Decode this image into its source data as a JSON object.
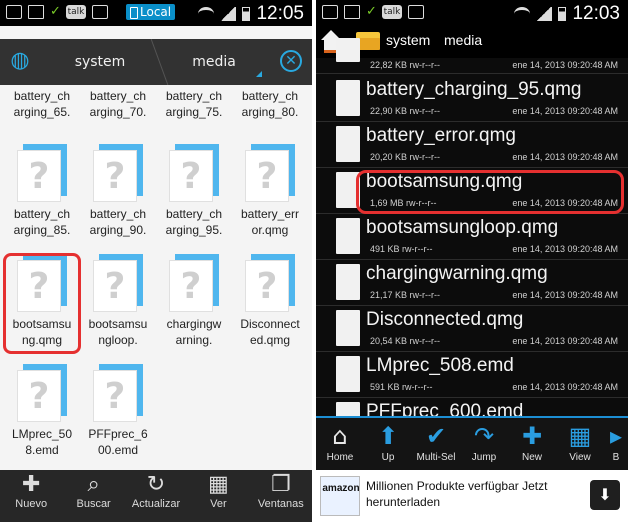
{
  "left": {
    "status": {
      "time": "12:05",
      "local_label": "Local",
      "talk_label": "talk"
    },
    "breadcrumb": [
      "system",
      "media"
    ],
    "grid_items": [
      "battery_ch\narging_65.",
      "battery_ch\narging_70.",
      "battery_ch\narging_75.",
      "battery_ch\narging_80.",
      "battery_ch\narging_85.",
      "battery_ch\narging_90.",
      "battery_ch\narging_95.",
      "battery_err\nor.qmg",
      "bootsamsu\nng.qmg",
      "bootsamsu\nngloop.",
      "chargingw\narning.",
      "Disconnect\ned.qmg",
      "LMprec_50\n8.emd",
      "PFFprec_6\n00.emd"
    ],
    "toolbar": [
      {
        "label": "Nuevo",
        "icon": "plus-icon"
      },
      {
        "label": "Buscar",
        "icon": "search-icon"
      },
      {
        "label": "Actualizar",
        "icon": "refresh-icon"
      },
      {
        "label": "Ver",
        "icon": "grid-view-icon"
      },
      {
        "label": "Ventanas",
        "icon": "windows-icon"
      }
    ]
  },
  "right": {
    "status": {
      "time": "12:03",
      "talk_label": "talk"
    },
    "breadcrumb": [
      "system",
      "media"
    ],
    "files": [
      {
        "name": "",
        "meta": "22,82 KB rw-r--r--",
        "date": "ene 14, 2013 09:20:48 AM"
      },
      {
        "name": "battery_charging_95.qmg",
        "meta": "22,90 KB rw-r--r--",
        "date": "ene 14, 2013 09:20:48 AM"
      },
      {
        "name": "battery_error.qmg",
        "meta": "20,20 KB rw-r--r--",
        "date": "ene 14, 2013 09:20:48 AM"
      },
      {
        "name": "bootsamsung.qmg",
        "meta": "1,69 MB rw-r--r--",
        "date": "ene 14, 2013 09:20:48 AM"
      },
      {
        "name": "bootsamsungloop.qmg",
        "meta": "491 KB rw-r--r--",
        "date": "ene 14, 2013 09:20:48 AM"
      },
      {
        "name": "chargingwarning.qmg",
        "meta": "21,17 KB rw-r--r--",
        "date": "ene 14, 2013 09:20:48 AM"
      },
      {
        "name": "Disconnected.qmg",
        "meta": "20,54 KB rw-r--r--",
        "date": "ene 14, 2013 09:20:48 AM"
      },
      {
        "name": "LMprec_508.emd",
        "meta": "591 KB rw-r--r--",
        "date": "ene 14, 2013 09:20:48 AM"
      },
      {
        "name": "PFFprec_600.emd",
        "meta": "",
        "date": ""
      }
    ],
    "toolbar": [
      {
        "label": "Home",
        "icon": "home-icon"
      },
      {
        "label": "Up",
        "icon": "up-arrow-icon"
      },
      {
        "label": "Multi-Sel",
        "icon": "checkmark-icon"
      },
      {
        "label": "Jump",
        "icon": "jump-arrow-icon"
      },
      {
        "label": "New",
        "icon": "plus-icon"
      },
      {
        "label": "View",
        "icon": "grid-view-icon"
      },
      {
        "label": "B",
        "icon": "more-icon"
      }
    ],
    "ad": {
      "brand": "amazon",
      "text": "Millionen Produkte verfügbar Jetzt herunterladen"
    }
  }
}
